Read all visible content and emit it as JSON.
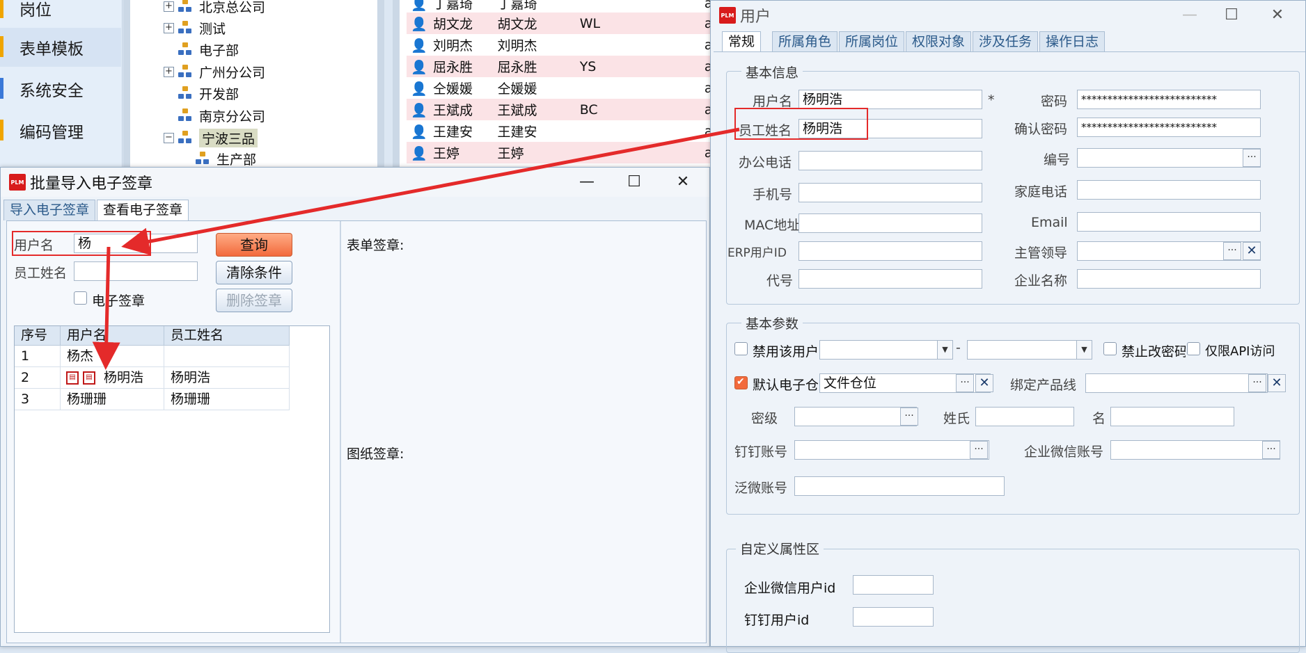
{
  "left_menu": {
    "items": [
      "岗位",
      "表单模板",
      "系统安全",
      "编码管理"
    ]
  },
  "org_tree": {
    "nodes": [
      "北京总公司",
      "测试",
      "电子部",
      "广州分公司",
      "开发部",
      "南京分公司",
      "宁波三品",
      "生产部"
    ]
  },
  "user_list": {
    "rows": [
      {
        "name": "丁嘉琦",
        "emp": "丁嘉琦",
        "code": "",
        "acc": "ac"
      },
      {
        "name": "胡文龙",
        "emp": "胡文龙",
        "code": "WL",
        "acc": "ac"
      },
      {
        "name": "刘明杰",
        "emp": "刘明杰",
        "code": "",
        "acc": "ac"
      },
      {
        "name": "屈永胜",
        "emp": "屈永胜",
        "code": "YS",
        "acc": "ac"
      },
      {
        "name": "仝媛媛",
        "emp": "仝媛媛",
        "code": "",
        "acc": "ac"
      },
      {
        "name": "王斌成",
        "emp": "王斌成",
        "code": "BC",
        "acc": "ac"
      },
      {
        "name": "王建安",
        "emp": "王建安",
        "code": "",
        "acc": "ac"
      },
      {
        "name": "王婷",
        "emp": "王婷",
        "code": "",
        "acc": "ac"
      }
    ]
  },
  "batch_dialog": {
    "app_logo": "PLM",
    "title": "批量导入电子签章",
    "win_min": "—",
    "win_max": "☐",
    "win_close": "✕",
    "tabs": [
      "导入电子签章",
      "查看电子签章"
    ],
    "username_label": "用户名",
    "username_value": "杨",
    "empname_label": "员工姓名",
    "empname_value": "",
    "esig_label": "电子签章",
    "query_btn": "查询",
    "clear_btn": "清除条件",
    "delete_btn": "删除签章",
    "grid_headers": [
      "序号",
      "用户名",
      "员工姓名"
    ],
    "grid_rows": [
      {
        "no": "1",
        "user": "杨杰",
        "emp": ""
      },
      {
        "no": "2",
        "user": "杨明浩",
        "emp": "杨明浩"
      },
      {
        "no": "3",
        "user": "杨珊珊",
        "emp": "杨珊珊"
      }
    ],
    "form_sig_label": "表单签章:",
    "drawing_sig_label": "图纸签章:"
  },
  "user_dialog": {
    "app_logo": "PLM",
    "title": "用户",
    "win_min": "—",
    "win_max": "☐",
    "win_close": "✕",
    "tabs": [
      "常规",
      "所属角色",
      "所属岗位",
      "权限对象",
      "涉及任务",
      "操作日志"
    ],
    "basic_info": {
      "title": "基本信息",
      "username_label": "用户名",
      "username": "杨明浩",
      "required": "*",
      "password_label": "密码",
      "password": "**************************",
      "empname_label": "员工姓名",
      "empname": "杨明浩",
      "confirm_label": "确认密码",
      "confirm": "**************************",
      "office_phone_label": "办公电话",
      "code_label": "编号",
      "mobile_label": "手机号",
      "home_phone_label": "家庭电话",
      "mac_label": "MAC地址",
      "email_label": "Email",
      "erp_label": "ERP用户ID",
      "supervisor_label": "主管领导",
      "alias_label": "代号",
      "company_label": "企业名称"
    },
    "basic_params": {
      "title": "基本参数",
      "disable_label": "禁用该用户",
      "dash": "-",
      "no_change_pwd_label": "禁止改密码",
      "api_only_label": "仅限API访问",
      "default_esig_label": "默认电子仓",
      "default_esig_value": "文件仓位",
      "bind_product_label": "绑定产品线",
      "secret_label": "密级",
      "surname_label": "姓氏",
      "givenname_label": "名",
      "dingtalk_label": "钉钉账号",
      "wecom_label": "企业微信账号",
      "fanwei_label": "泛微账号"
    },
    "custom": {
      "title": "自定义属性区",
      "wecom_uid_label": "企业微信用户id",
      "dingtalk_uid_label": "钉钉用户id"
    }
  },
  "colors": {
    "accent": "#f26a3c",
    "annotation": "#e42a2a"
  }
}
